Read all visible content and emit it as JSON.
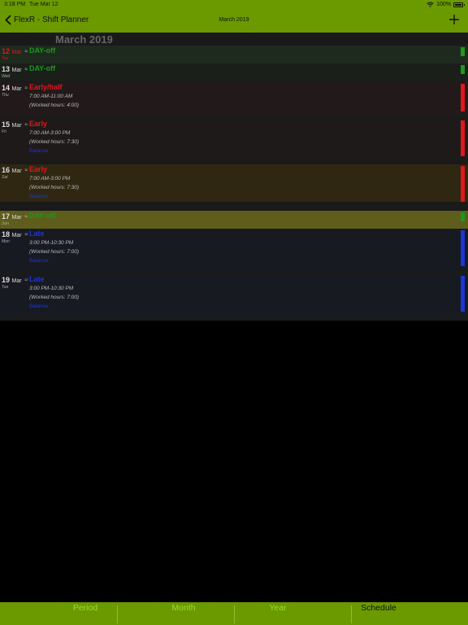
{
  "status": {
    "time": "3:18 PM",
    "date": "Tue Mar 12",
    "battery": "100%"
  },
  "nav": {
    "back_label": "FlexR - Shift Planner",
    "title": "March 2019"
  },
  "month_header": "March 2019",
  "rows": [
    {
      "day": "12",
      "mon": "Mar",
      "dow": "Tue",
      "week": "11",
      "shift": "DAY-off"
    },
    {
      "day": "13",
      "mon": "Mar",
      "dow": "Wed",
      "week": "11",
      "shift": "DAY-off"
    },
    {
      "day": "14",
      "mon": "Mar",
      "dow": "Thu",
      "week": "11",
      "shift": "Early/half",
      "hours": "7:00 AM-11:00 AM",
      "worked": "(Worked hours: 4:00)"
    },
    {
      "day": "15",
      "mon": "Mar",
      "dow": "Fri",
      "week": "11",
      "shift": "Early",
      "hours": "7:00 AM-3:00 PM",
      "worked": "(Worked hours: 7:30)",
      "extra": "Balance"
    },
    {
      "day": "16",
      "mon": "Mar",
      "dow": "Sat",
      "week": "11",
      "shift": "Early",
      "hours": "7:00 AM-3:00 PM",
      "worked": "(Worked hours: 7:30)",
      "extra": "Balance"
    },
    {
      "day": "17",
      "mon": "Mar",
      "dow": "Sun",
      "week": "11",
      "shift": "DAY-off"
    },
    {
      "day": "18",
      "mon": "Mar",
      "dow": "Mon",
      "week": "12",
      "shift": "Late",
      "hours": "3:00 PM-10:30 PM",
      "worked": "(Worked hours: 7:00)",
      "extra": "Balance"
    },
    {
      "day": "19",
      "mon": "Mar",
      "dow": "Tue",
      "week": "12",
      "shift": "Late",
      "hours": "3:00 PM-10:30 PM",
      "worked": "(Worked hours: 7:00)",
      "extra": "Balance"
    }
  ],
  "tabs": {
    "period": "Period",
    "month": "Month",
    "year": "Year",
    "schedule": "Schedule"
  },
  "colors": {
    "accent": "#6a9a00",
    "dayoff": "#1a9a1a",
    "early": "#e0161a",
    "late": "#1a35d8",
    "today": "#e0161a"
  }
}
